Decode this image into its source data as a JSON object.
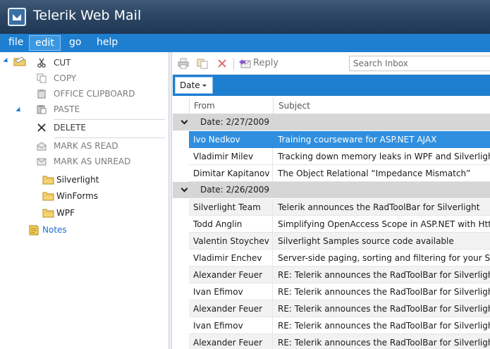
{
  "app": {
    "title": "Telerik Web Mail"
  },
  "menu": [
    {
      "label": "file",
      "active": false
    },
    {
      "label": "edit",
      "active": true
    },
    {
      "label": "go",
      "active": false
    },
    {
      "label": "help",
      "active": false
    }
  ],
  "commands": {
    "cut": "CUT",
    "copy": "COPY",
    "office_clipboard": "OFFICE CLIPBOARD",
    "paste": "PASTE",
    "delete": "DELETE",
    "mark_read": "MARK AS READ",
    "mark_unread": "MARK AS UNREAD"
  },
  "folders": {
    "silverlight": "Silverlight",
    "winforms": "WinForms",
    "wpf": "WPF",
    "notes": "Notes"
  },
  "toolbar": {
    "reply": "Reply",
    "search_placeholder": "Search Inbox"
  },
  "grouping": {
    "chip": "Date"
  },
  "grid": {
    "columns": {
      "from": "From",
      "subject": "Subject"
    },
    "groups": [
      {
        "label": "Date: 2/27/2009",
        "rows": [
          {
            "from": "Ivo Nedkov",
            "subject": "Training courseware for ASP.NET AJAX",
            "selected": true
          },
          {
            "from": "Vladimir Milev",
            "subject": "Tracking down memory leaks in WPF and Silverlight"
          },
          {
            "from": "Dimitar Kapitanov",
            "subject": "The Object Relational “Impedance Mismatch”"
          }
        ]
      },
      {
        "label": "Date: 2/26/2009",
        "rows": [
          {
            "from": "Silverlight Team",
            "subject": "Telerik announces the RadToolBar for Silverlight"
          },
          {
            "from": "Todd Anglin",
            "subject": "Simplifying OpenAccess Scope in ASP.NET with HttpModule"
          },
          {
            "from": "Valentin Stoychev",
            "subject": "Silverlight Samples source code available"
          },
          {
            "from": "Vladimir Enchev",
            "subject": "Server-side paging, sorting and filtering for your Silverlight"
          },
          {
            "from": "Alexander Feuer",
            "subject": "RE: Telerik announces the RadToolBar for Silverlight"
          },
          {
            "from": "Ivan Efimov",
            "subject": "RE: Telerik announces the RadToolBar for Silverlight"
          },
          {
            "from": "Alexander Feuer",
            "subject": "RE: Telerik announces the RadToolBar for Silverlight"
          },
          {
            "from": "Ivan Efimov",
            "subject": "RE: Telerik announces the RadToolBar for Silverlight"
          },
          {
            "from": "Alexander Feuer",
            "subject": "RE: Telerik announces the RadToolBar for Silverlight"
          }
        ]
      }
    ]
  },
  "colors": {
    "titlebar": "#2c4663",
    "menubar": "#1e7fd0",
    "selection": "#2f8fde",
    "group_row": "#d6d6d6",
    "link": "#1e6fd0"
  }
}
